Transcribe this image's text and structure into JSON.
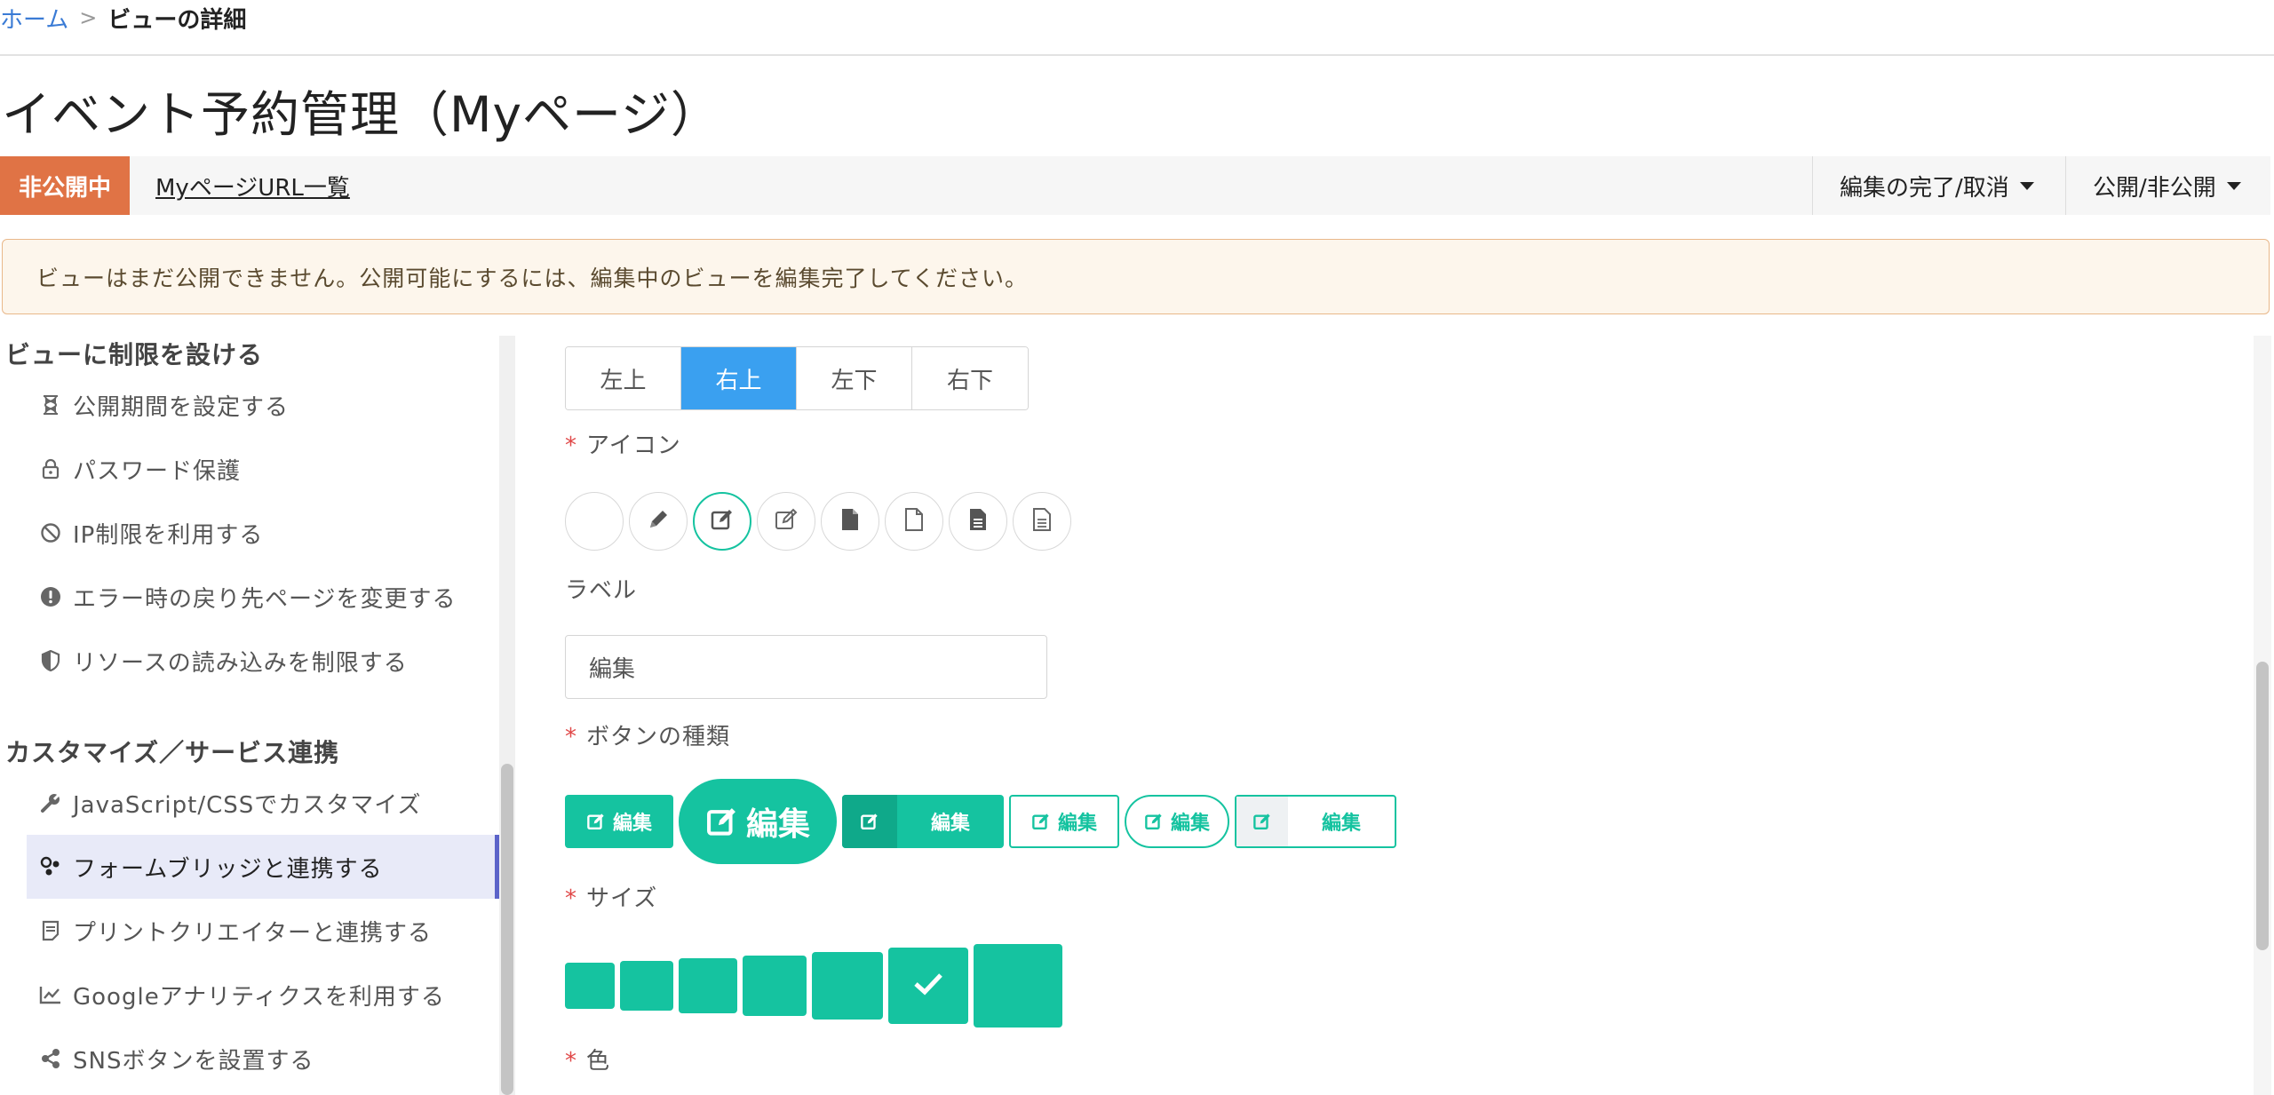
{
  "breadcrumb": {
    "home": "ホーム",
    "separator": ">",
    "current": "ビューの詳細"
  },
  "page_title": "イベント予約管理（Myページ）",
  "status_bar": {
    "badge": "非公開中",
    "url_link": "MyページURL一覧",
    "edit_dropdown": "編集の完了/取消",
    "publish_dropdown": "公開/非公開"
  },
  "alert": "ビューはまだ公開できません。公開可能にするには、編集中のビューを編集完了してください。",
  "sidebar": {
    "section1": "ビューに制限を設ける",
    "items1": [
      {
        "label": "公開期間を設定する",
        "icon": "hourglass-icon"
      },
      {
        "label": "パスワード保護",
        "icon": "lock-icon"
      },
      {
        "label": "IP制限を利用する",
        "icon": "ban-icon"
      },
      {
        "label": "エラー時の戻り先ページを変更する",
        "icon": "exclamation-circle-icon"
      },
      {
        "label": "リソースの読み込みを制限する",
        "icon": "shield-icon"
      }
    ],
    "section2": "カスタマイズ／サービス連携",
    "items2": [
      {
        "label": "JavaScript/CSSでカスタマイズ",
        "icon": "wrench-icon"
      },
      {
        "label": "フォームブリッジと連携する",
        "icon": "plugin-icon",
        "active": true
      },
      {
        "label": "プリントクリエイターと連携する",
        "icon": "print-doc-icon"
      },
      {
        "label": "Googleアナリティクスを利用する",
        "icon": "line-chart-icon"
      },
      {
        "label": "SNSボタンを設置する",
        "icon": "share-icon"
      }
    ]
  },
  "position": {
    "options": [
      "左上",
      "右上",
      "左下",
      "右下"
    ],
    "selected": "右上"
  },
  "icon_field": {
    "required_mark": "*",
    "label": "アイコン",
    "options": [
      "none",
      "pencil-icon",
      "edit-icon",
      "edit-outline-icon",
      "file-icon",
      "file-outline-icon",
      "file-text-icon",
      "file-text-outline-icon"
    ],
    "selected": "edit-icon"
  },
  "label_field": {
    "label": "ラベル",
    "value": "編集"
  },
  "button_type_field": {
    "required_mark": "*",
    "label": "ボタンの種類",
    "sample_text": "編集"
  },
  "size_field": {
    "required_mark": "*",
    "label": "サイズ",
    "selected_index": 5
  },
  "color_field": {
    "required_mark": "*",
    "label": "色"
  },
  "colors": {
    "accent": "#15c3a0",
    "badge": "#e07345",
    "active_tab": "#3aa0f0"
  }
}
